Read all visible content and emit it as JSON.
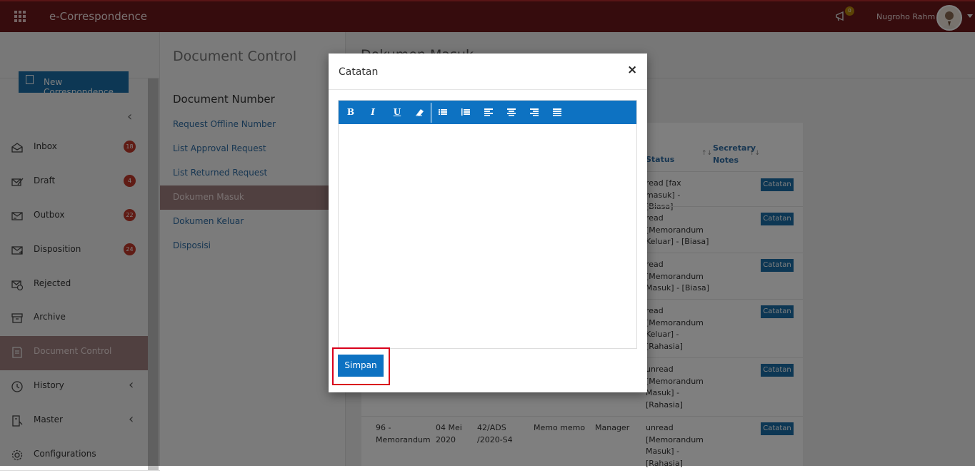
{
  "app": {
    "title": "e-Correspondence",
    "notification_count": "0",
    "username": "Nugroho Rahm"
  },
  "sidebar": {
    "new_button": "New Correspondence",
    "items": [
      {
        "label": "Inbox",
        "badge": "18",
        "icon": "inbox-icon"
      },
      {
        "label": "Draft",
        "badge": "4",
        "icon": "draft-icon"
      },
      {
        "label": "Outbox",
        "badge": "22",
        "icon": "outbox-icon"
      },
      {
        "label": "Disposition",
        "badge": "24",
        "icon": "disposition-icon"
      },
      {
        "label": "Rejected",
        "badge": "",
        "icon": "rejected-icon"
      },
      {
        "label": "Archive",
        "badge": "",
        "icon": "archive-icon"
      },
      {
        "label": "Document Control",
        "badge": "",
        "icon": "document-control-icon",
        "active": true
      },
      {
        "label": "History",
        "badge": "",
        "icon": "history-icon"
      },
      {
        "label": "Master",
        "badge": "",
        "icon": "master-icon"
      },
      {
        "label": "Configurations",
        "badge": "",
        "icon": "gear-icon"
      }
    ]
  },
  "subnav": {
    "title": "Document Control",
    "section": "Document Number",
    "links": [
      "Request Offline Number",
      "List Approval Request",
      "List Returned Request",
      "Dokumen Masuk",
      "Dokumen Keluar",
      "Disposisi"
    ]
  },
  "main": {
    "title": "Dokumen Masuk",
    "columns": {
      "status": "Status",
      "notes": "Secretary Notes"
    },
    "rows": [
      {
        "status": "read [fax masuk] - [Biasa]"
      },
      {
        "status": "read [Memorandum Keluar] - [Biasa]"
      },
      {
        "status": "read [Memorandum Masuk] - [Biasa]"
      },
      {
        "status": "read [Memorandum Keluar] - [Rahasia]"
      },
      {
        "status": "unread [Memorandum Masuk] - [Rahasia]"
      },
      {
        "no": "96 - Memorandum",
        "date": "04 Mei 2020",
        "number": "42/ADS /2020-S4",
        "subject": "Memo memo",
        "from": "Manager",
        "status": "unread [Memorandum Masuk] - [Rahasia]"
      }
    ],
    "notes_button": "Catatan"
  },
  "modal": {
    "title": "Catatan",
    "close": "×",
    "save": "Simpan",
    "toolbar": {
      "bold": "B",
      "italic": "I",
      "underline": "U"
    }
  }
}
